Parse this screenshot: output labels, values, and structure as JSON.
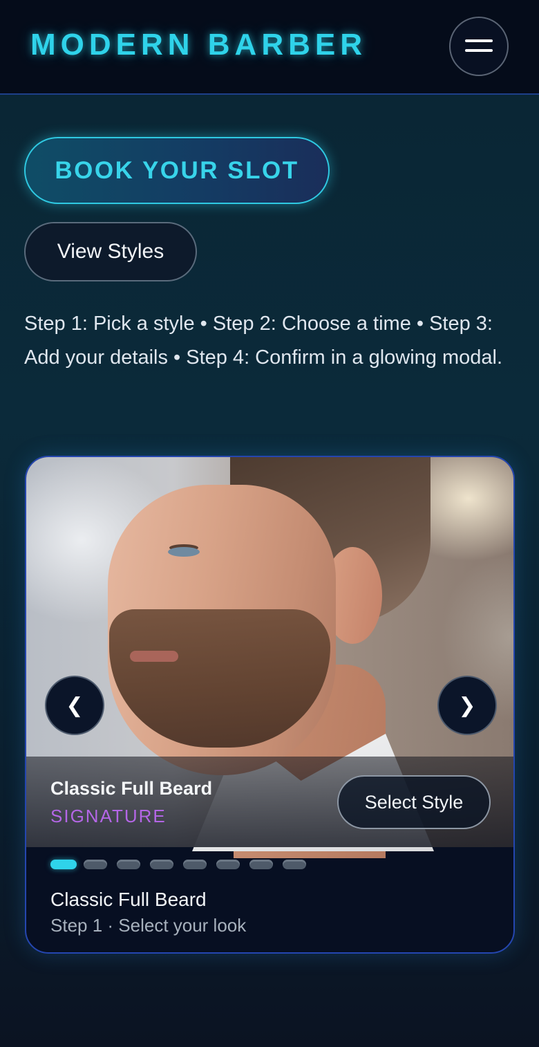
{
  "header": {
    "brand": "MODERN BARBER",
    "menu_icon": "hamburger-menu-icon"
  },
  "hero": {
    "book_label": "BOOK YOUR SLOT",
    "view_label": "View Styles",
    "steps_text": "Step 1: Pick a style • Step 2: Choose a time • Step 3: Add your details • Step 4: Confirm in a glowing modal."
  },
  "carousel": {
    "prev_glyph": "❮",
    "next_glyph": "❯",
    "slide": {
      "name": "Classic Full Beard",
      "tag": "SIGNATURE",
      "select_label": "Select Style"
    },
    "dots": {
      "count": 8,
      "active_index": 0
    },
    "footer_title": "Classic Full Beard",
    "footer_subtitle": "Step 1 · Select your look"
  },
  "colors": {
    "accent_cyan": "#2fd3ea",
    "accent_purple": "#b466e6",
    "header_bg": "#050c1a",
    "card_border": "#2546b0"
  }
}
